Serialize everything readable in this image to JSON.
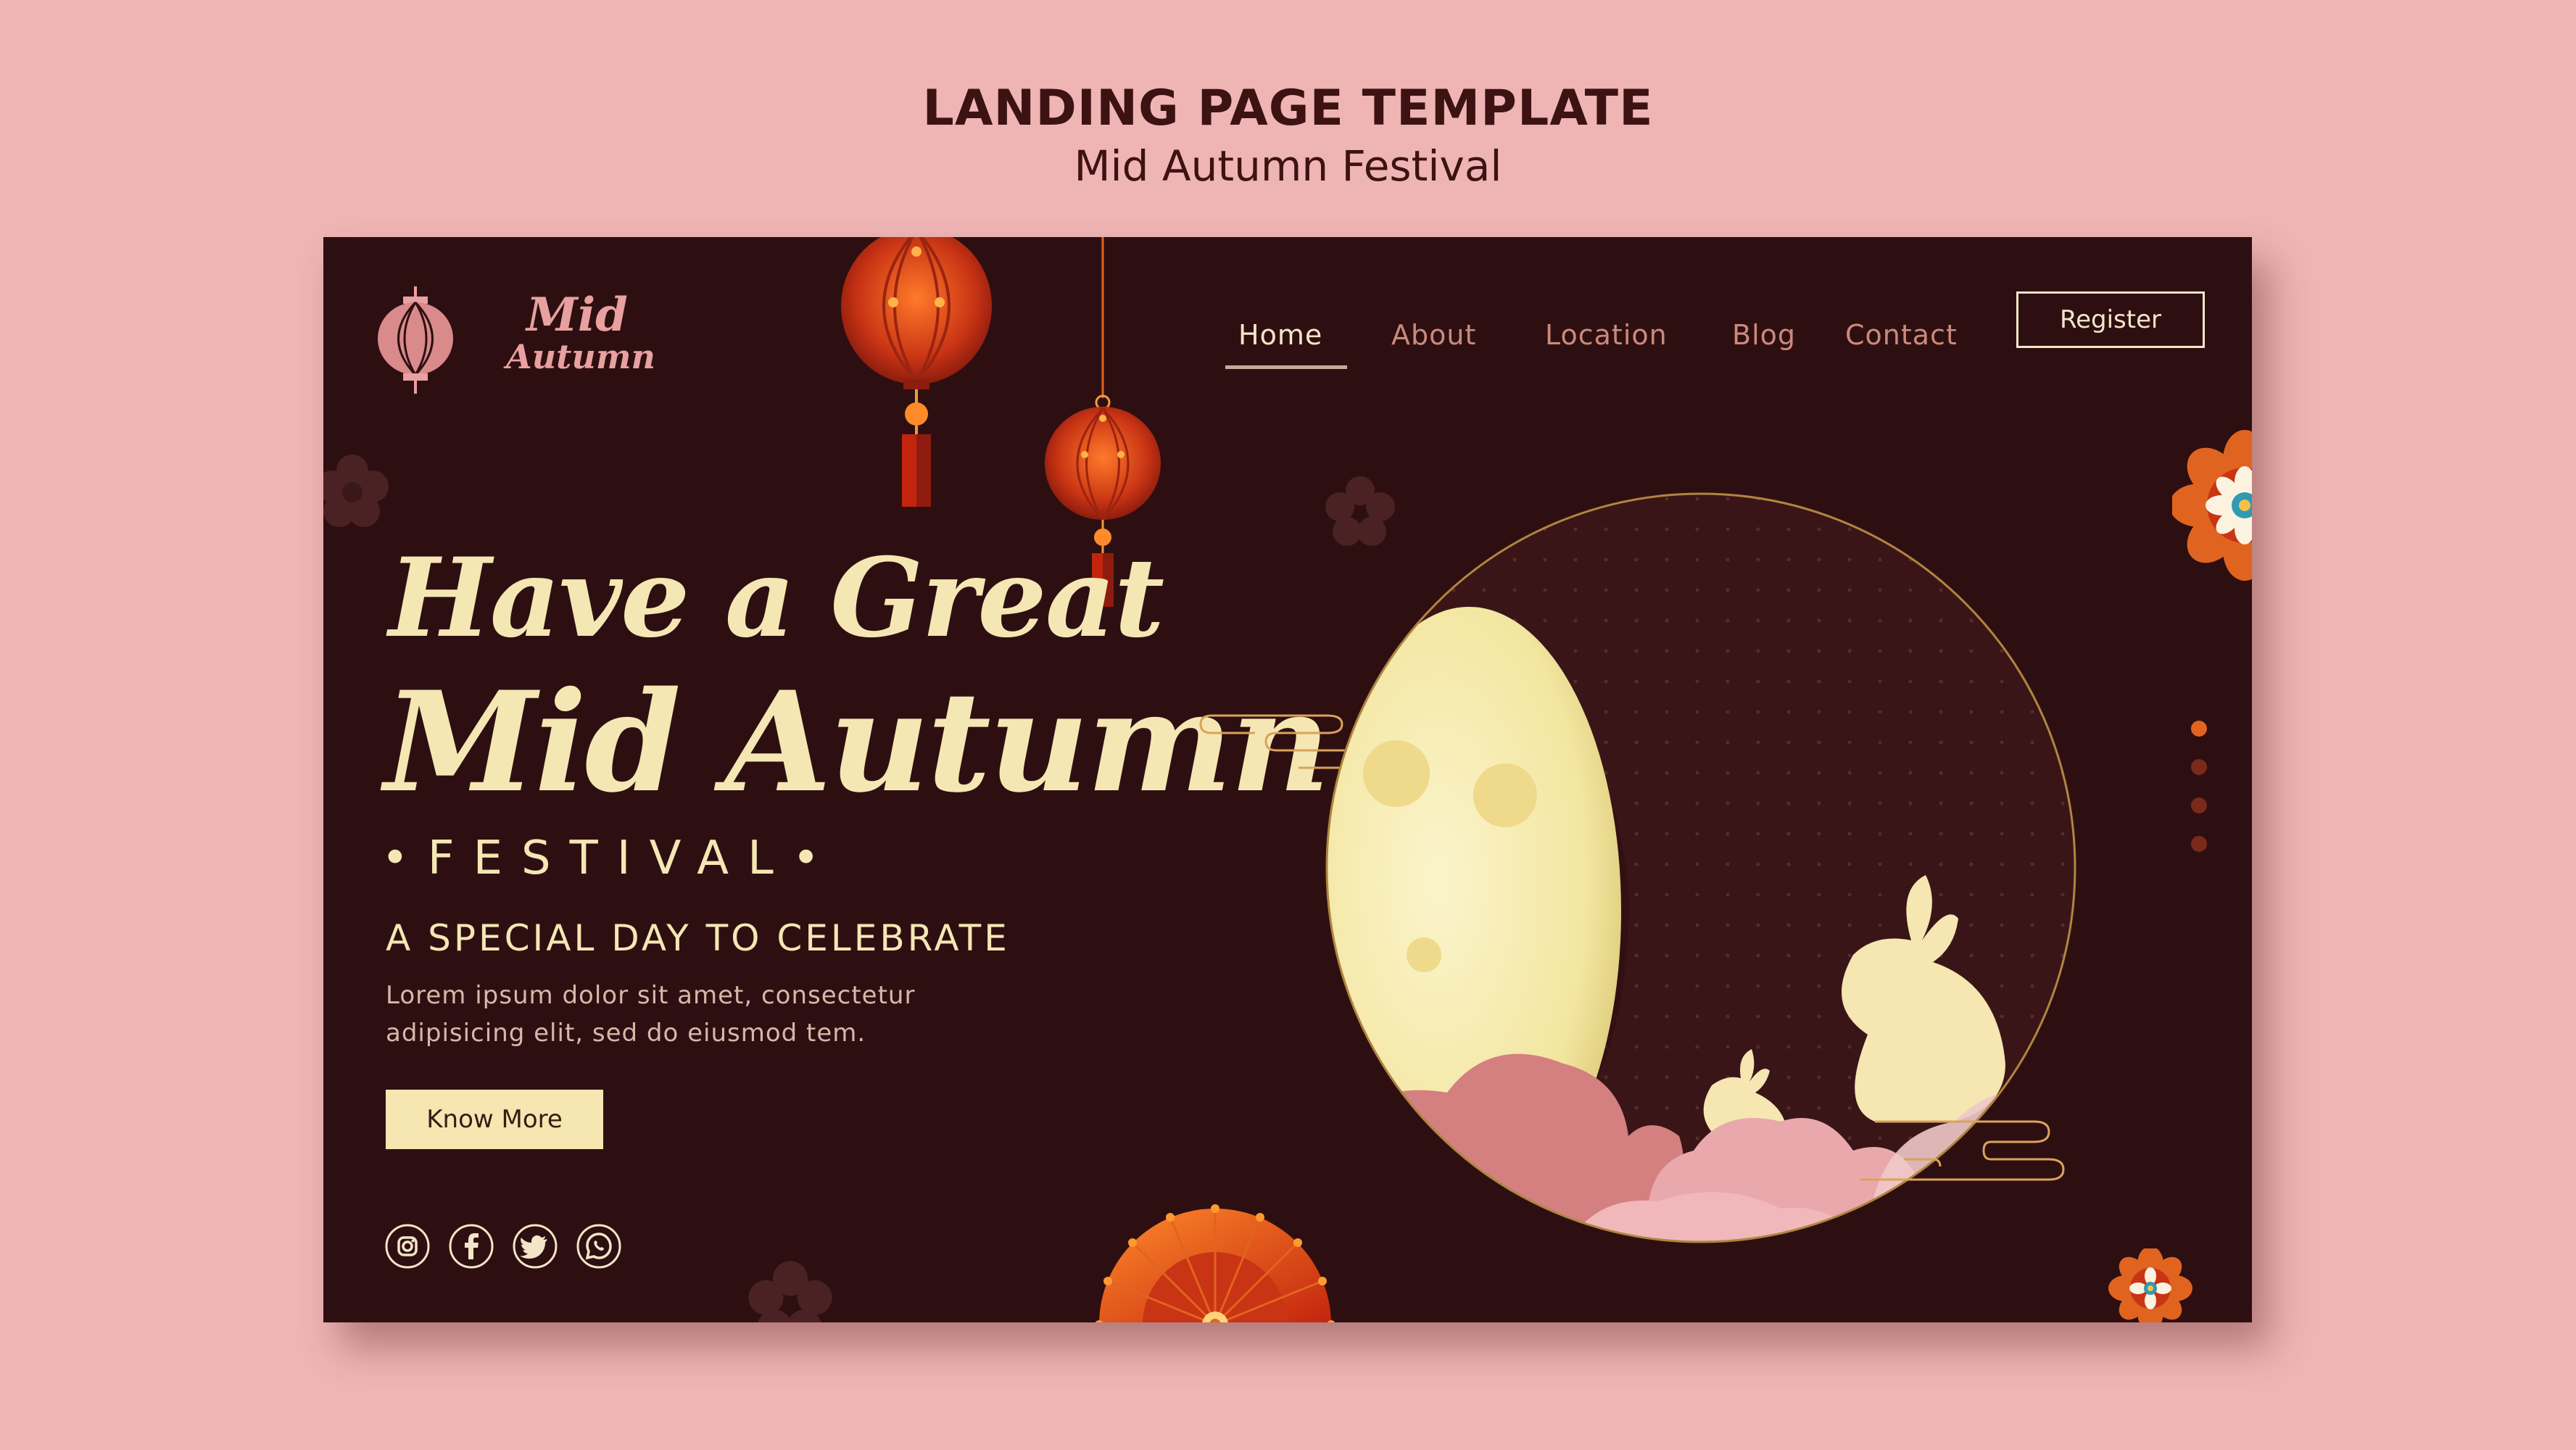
{
  "showcase": {
    "title": "LANDING PAGE TEMPLATE",
    "subtitle": "Mid Autumn Festival"
  },
  "logo": {
    "line1": "Mid",
    "line2": "Autumn"
  },
  "nav": {
    "items": [
      "Home",
      "About",
      "Location",
      "Blog",
      "Contact"
    ],
    "active": "Home",
    "register_label": "Register"
  },
  "hero": {
    "line1": "Have a Great",
    "line2": "Mid Autumn",
    "festival": "•FESTIVAL•",
    "tagline": "A SPECIAL DAY TO CELEBRATE",
    "body_line1": "Lorem ipsum dolor sit amet, consectetur",
    "body_line2": "adipisicing elit, sed do eiusmod tem.",
    "button_label": "Know More"
  },
  "social": [
    "instagram-icon",
    "facebook-icon",
    "twitter-icon",
    "whatsapp-icon"
  ],
  "slider": {
    "count": 4,
    "active_index": 0
  },
  "colors": {
    "background": "#efb4b4",
    "panel": "#2e0f11",
    "cream": "#f4e7b4",
    "nav_inactive": "#c98a7c",
    "accent_orange": "#e06420",
    "pink": "#e9a0a0"
  },
  "icons": [
    "lantern-icon",
    "moon-icon",
    "rabbit-icon",
    "cloud-icon",
    "flower-icon",
    "fan-icon"
  ]
}
